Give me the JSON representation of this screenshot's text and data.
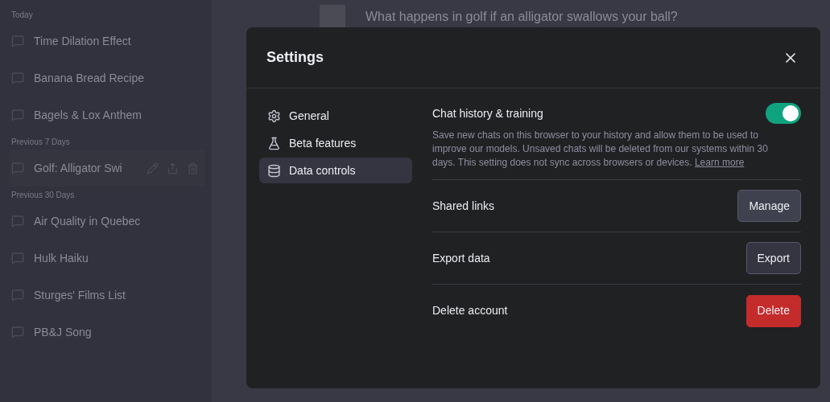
{
  "sidebar": {
    "groups": [
      {
        "label": "Today",
        "items": [
          {
            "title": "Time Dilation Effect",
            "hovered": false
          },
          {
            "title": "Banana Bread Recipe",
            "hovered": false
          },
          {
            "title": "Bagels & Lox Anthem",
            "hovered": false
          }
        ]
      },
      {
        "label": "Previous 7 Days",
        "items": [
          {
            "title": "Golf: Alligator Swi",
            "hovered": true
          }
        ]
      },
      {
        "label": "Previous 30 Days",
        "items": [
          {
            "title": "Air Quality in Quebec",
            "hovered": false
          },
          {
            "title": "Hulk Haiku",
            "hovered": false
          },
          {
            "title": "Sturges' Films List",
            "hovered": false
          },
          {
            "title": "PB&J Song",
            "hovered": false
          }
        ]
      }
    ]
  },
  "chat": {
    "question": "What happens in golf if an alligator swallows your ball?"
  },
  "dialog": {
    "title": "Settings",
    "nav": [
      {
        "kind": "gear",
        "label": "General",
        "selected": false
      },
      {
        "kind": "flask",
        "label": "Beta features",
        "selected": false
      },
      {
        "kind": "database",
        "label": "Data controls",
        "selected": true
      }
    ],
    "rows": [
      {
        "kind": "toggle",
        "label": "Chat history & training",
        "on": true,
        "description": "Save new chats on this browser to your history and allow them to be used to improve our models. Unsaved chats will be deleted from our systems within 30 days. This setting does not sync across browsers or devices.",
        "link": "Learn more"
      },
      {
        "kind": "button",
        "label": "Shared links",
        "button": "Manage",
        "danger": false,
        "hovered": true
      },
      {
        "kind": "button",
        "label": "Export data",
        "button": "Export",
        "danger": false,
        "hovered": false
      },
      {
        "kind": "button",
        "label": "Delete account",
        "button": "Delete",
        "danger": true
      }
    ]
  }
}
